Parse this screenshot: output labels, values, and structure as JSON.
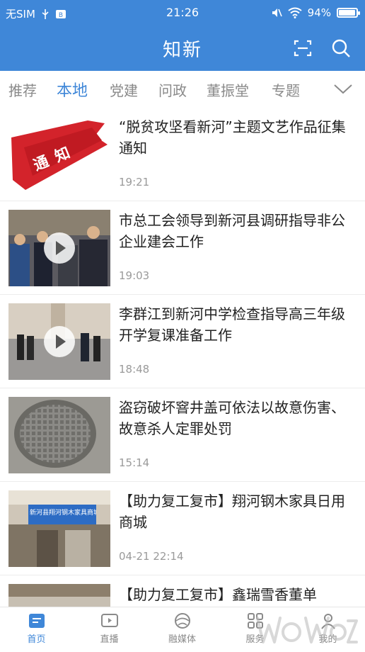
{
  "status_bar": {
    "carrier": "无SIM",
    "time": "21:26",
    "battery_text": "94%",
    "battery_level": 0.94
  },
  "nav": {
    "title": "知新",
    "scan_icon": "scan-icon",
    "search_icon": "search-icon"
  },
  "tabs": [
    {
      "label": "推荐",
      "active": false
    },
    {
      "label": "本地",
      "active": true
    },
    {
      "label": "党建",
      "active": false
    },
    {
      "label": "问政",
      "active": false
    },
    {
      "label": "董振堂",
      "active": false
    },
    {
      "label": "专题",
      "active": false
    }
  ],
  "feed": [
    {
      "title": "“脱贫攻坚看新河”主题文艺作品征集通知",
      "time": "19:21",
      "thumb_text": "通 知",
      "video": false
    },
    {
      "title": "市总工会领导到新河县调研指导非公企业建会工作",
      "time": "19:03",
      "video": true
    },
    {
      "title": "李群江到新河中学检查指导高三年级开学复课准备工作",
      "time": "18:48",
      "video": true
    },
    {
      "title": "盗窃破坏窨井盖可依法以故意伤害、故意杀人定罪处罚",
      "time": "15:14",
      "video": false
    },
    {
      "title": "【助力复工复市】翔河钢木家具日用商城",
      "time": "04-21 22:14",
      "thumb_text": "新河县翔河钢木家具商城",
      "video": false
    },
    {
      "title": "【助力复工复市】鑫瑞雪香董单",
      "time": "",
      "video": false
    }
  ],
  "bottom_nav": [
    {
      "label": "首页",
      "icon": "home-icon",
      "active": true
    },
    {
      "label": "直播",
      "icon": "live-icon",
      "active": false
    },
    {
      "label": "融媒体",
      "icon": "media-icon",
      "active": false
    },
    {
      "label": "服务",
      "icon": "service-icon",
      "active": false
    },
    {
      "label": "我的",
      "icon": "user-icon",
      "active": false
    }
  ],
  "colors": {
    "brand_blue": "#3f87d8",
    "text_dark": "#222222",
    "text_gray": "#9a9a9a",
    "tab_gray": "#8a8a8a"
  }
}
